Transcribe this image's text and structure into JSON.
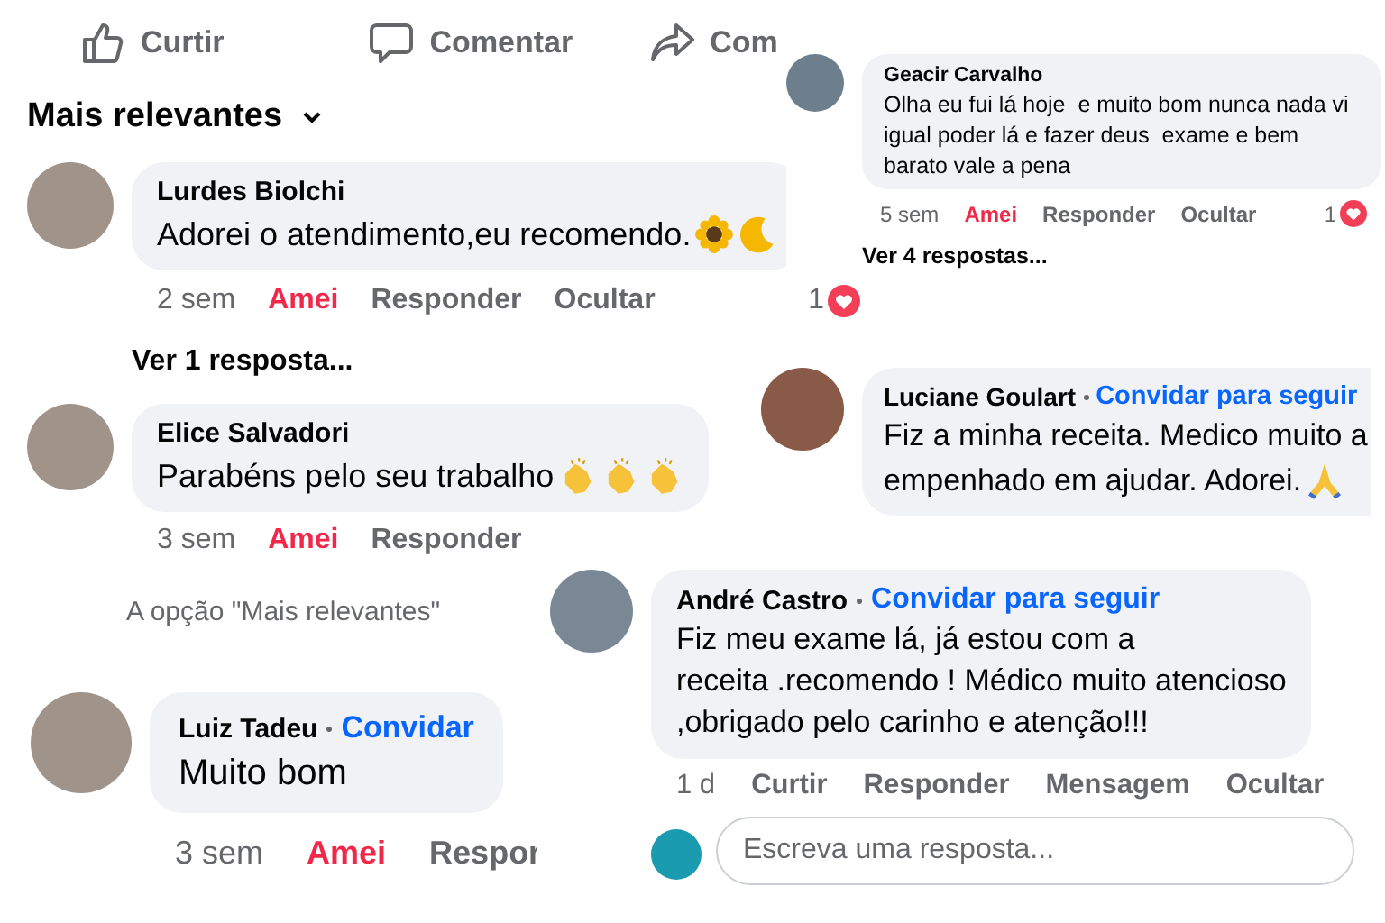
{
  "post_actions": [
    {
      "label": "Curtir",
      "kind": "like"
    },
    {
      "label": "Comentar",
      "kind": "comment"
    },
    {
      "label": "Com",
      "kind": "share"
    }
  ],
  "sort": {
    "label": "Mais relevantes"
  },
  "comments": [
    {
      "name": "Lurdes Biolchi",
      "text": [
        "Adorei o atendimento,eu recomendo."
      ],
      "emojis": [
        {
          "kind": "sunflower"
        },
        {
          "kind": "moon"
        }
      ],
      "time": "2 sem",
      "actions": [
        {
          "label": "Amei",
          "selected": true
        },
        {
          "label": "Responder",
          "selected": false
        },
        {
          "label": "Ocultar",
          "selected": false
        }
      ],
      "reactions": "1",
      "replies": "Ver 1 resposta..."
    },
    {
      "name": "Elice Salvadori",
      "text": [
        "Parabéns pelo seu trabalho"
      ],
      "emojis": [
        {
          "kind": "clap"
        },
        {
          "kind": "clap"
        },
        {
          "kind": "clap"
        }
      ],
      "time": "3 sem",
      "actions": [
        {
          "label": "Amei",
          "selected": true
        },
        {
          "label": "Responder",
          "selected": false
        }
      ]
    },
    {
      "name": "Luiz Tadeu",
      "invite": "Convidar",
      "text": [
        "Muito bom"
      ],
      "time": "3 sem",
      "actions": [
        {
          "label": "Amei",
          "selected": true
        },
        {
          "label": "Respor",
          "selected": false
        }
      ]
    },
    {
      "name": "Geacir Carvalho",
      "text": [
        "Olha eu fui lá hoje  e muito bom nunca nada vi",
        "igual poder lá e fazer deus  exame e bem",
        "barato vale a pena"
      ],
      "time": "5 sem",
      "actions": [
        {
          "label": "Amei",
          "selected": true
        },
        {
          "label": "Responder",
          "selected": false
        },
        {
          "label": "Ocultar",
          "selected": false
        }
      ],
      "reactions": "1",
      "replies": "Ver 4 respostas..."
    },
    {
      "name": "Luciane Goulart",
      "invite": "Convidar para seguir",
      "text": [
        "Fiz a minha receita. Medico muito a",
        "empenhado em ajudar. Adorei."
      ],
      "emojis": [
        {
          "kind": "pray"
        }
      ]
    },
    {
      "name": "André Castro",
      "invite": "Convidar para seguir",
      "text": [
        "Fiz meu exame lá, já estou com a",
        "receita .recomendo ! Médico muito atencioso",
        ",obrigado pelo carinho e atenção!!!"
      ],
      "time": "1 d",
      "actions": [
        {
          "label": "Curtir",
          "selected": false
        },
        {
          "label": "Responder",
          "selected": false
        },
        {
          "label": "Mensagem",
          "selected": false
        },
        {
          "label": "Ocultar",
          "selected": false
        }
      ],
      "reply_box": {
        "placeholder": "Escreva uma resposta..."
      }
    }
  ],
  "notice": "A opção \"Mais relevantes\""
}
